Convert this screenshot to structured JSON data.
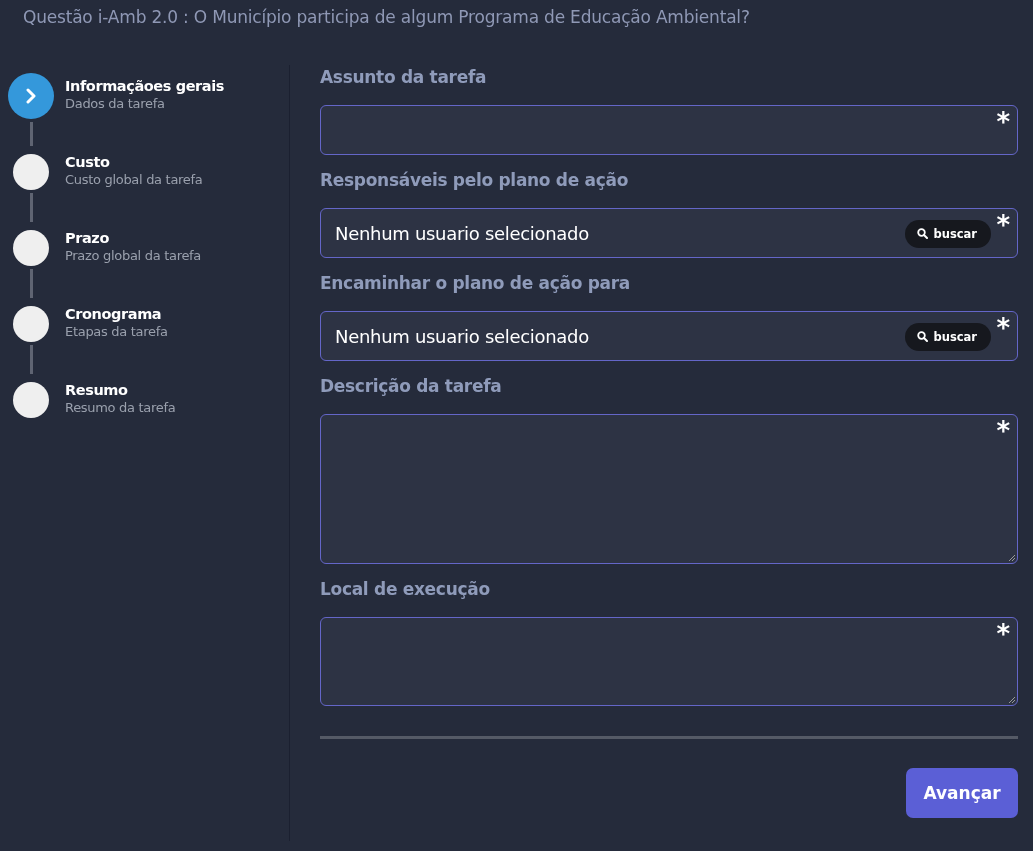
{
  "page_title": "Questão i-Amb 2.0 : O Município participa de algum Programa de Educação Ambiental?",
  "steps": [
    {
      "title": "Informaçãoes gerais",
      "subtitle": "Dados da tarefa",
      "selected": true
    },
    {
      "title": "Custo",
      "subtitle": "Custo global da tarefa",
      "selected": false
    },
    {
      "title": "Prazo",
      "subtitle": "Prazo global da tarefa",
      "selected": false
    },
    {
      "title": "Cronograma",
      "subtitle": "Etapas da tarefa",
      "selected": false
    },
    {
      "title": "Resumo",
      "subtitle": "Resumo da tarefa",
      "selected": false
    }
  ],
  "fields": [
    {
      "kind": "text",
      "label": "Assunto da tarefa",
      "required_mark": "*"
    },
    {
      "kind": "picker",
      "label": "Responsáveis pelo plano de ação",
      "value": "Nenhum usuario selecionado",
      "button": "buscar",
      "required_mark": "*"
    },
    {
      "kind": "picker",
      "label": "Encaminhar o plano de ação para",
      "value": "Nenhum usuario selecionado",
      "button": "buscar",
      "required_mark": "*"
    },
    {
      "kind": "textarea",
      "label": "Descrição da tarefa",
      "required_mark": "*"
    },
    {
      "kind": "memo",
      "label": "Local de execução",
      "required_mark": "*"
    }
  ],
  "next_button": "Avançar"
}
